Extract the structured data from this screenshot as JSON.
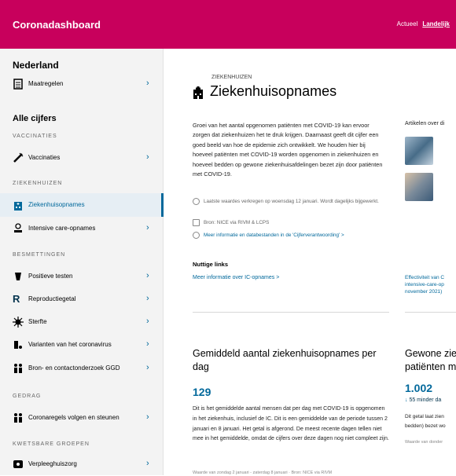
{
  "header": {
    "brand": "Coronadashboard",
    "nav": [
      "Actueel",
      "Landelijk"
    ],
    "active_nav": "Landelijk",
    "color": "#c8005c"
  },
  "sidebar": {
    "region": "Nederland",
    "measures": "Maatregelen",
    "all_figures": "Alle cijfers",
    "categories": {
      "vaccinaties": "VACCINATIES",
      "ziekenhuizen": "ZIEKENHUIZEN",
      "besmettingen": "BESMETTINGEN",
      "gedrag": "GEDRAG",
      "kwetsbare": "KWETSBARE GROEPEN"
    },
    "items": [
      {
        "label": "Vaccinaties",
        "icon": "syringe-icon"
      },
      {
        "label": "Ziekenhuisopnames",
        "icon": "hospital-icon",
        "active": true
      },
      {
        "label": "Intensive care-opnames",
        "icon": "ic-bed-icon"
      },
      {
        "label": "Positieve testen",
        "icon": "test-icon"
      },
      {
        "label": "Reproductiegetal",
        "icon": "r-letter-icon"
      },
      {
        "label": "Sterfte",
        "icon": "virus-icon"
      },
      {
        "label": "Varianten van het coronavirus",
        "icon": "variant-icon"
      },
      {
        "label": "Bron- en contactonderzoek GGD",
        "icon": "people-icon"
      },
      {
        "label": "Coronaregels volgen en steunen",
        "icon": "people-icon"
      },
      {
        "label": "Verpleeghuiszorg",
        "icon": "care-home-icon"
      }
    ]
  },
  "main": {
    "section": "ZIEKENHUIZEN",
    "title": "Ziekenhuisopnames",
    "intro": "Groei van het aantal opgenomen patiënten met COVID-19 kan ervoor zorgen dat ziekenhuizen het te druk krijgen. Daarnaast geeft dit cijfer een goed beeld van hoe de epidemie zich ontwikkelt. We houden hier bij hoeveel patiënten met COVID-19 worden opgenomen in ziekenhuizen en hoeveel bedden op gewone ziekenhuisafdelingen bezet zijn door patiënten met COVID-19.",
    "meta": {
      "updated": "Laatste waardes verkregen op woensdag 12 januari. Wordt dagelijks bijgewerkt.",
      "source": "Bron: NICE via RIVM & LCPS",
      "more_info": "Meer informatie en databestanden in de 'Cijferverantwoording' >"
    },
    "useful_links_title": "Nuttige links",
    "useful_link": "Meer informatie over IC-opnames >",
    "articles_title": "Artikelen over di",
    "article_caption": "Effectiviteit van C intensive-care-op november 2021)",
    "card1": {
      "title": "Gemiddeld aantal ziekenhuisopnames per dag",
      "value": "129",
      "text": "Dit is het gemiddelde aantal mensen dat per dag met COVID-19 is opgenomen in het ziekenhuis, inclusief de IC. Dit is een gemiddelde van de periode tussen 2 januari en 8 januari. Het getal is afgerond. De meest recente dagen tellen niet mee in het gemiddelde, omdat de cijfers over deze dagen nog niet compleet zijn.",
      "source": "Waarde van zondag 2 januari - zaterdag 8 januari · Bron: NICE via RIVM"
    },
    "card2": {
      "title_line1": "Gewone ziek",
      "title_line2": "patiënten m",
      "value": "1.002",
      "delta": "55 minder da",
      "text_line1": "Dit getal laat zien",
      "text_line2": "bedden) bezet wo",
      "source": "Waarde van donder"
    }
  }
}
